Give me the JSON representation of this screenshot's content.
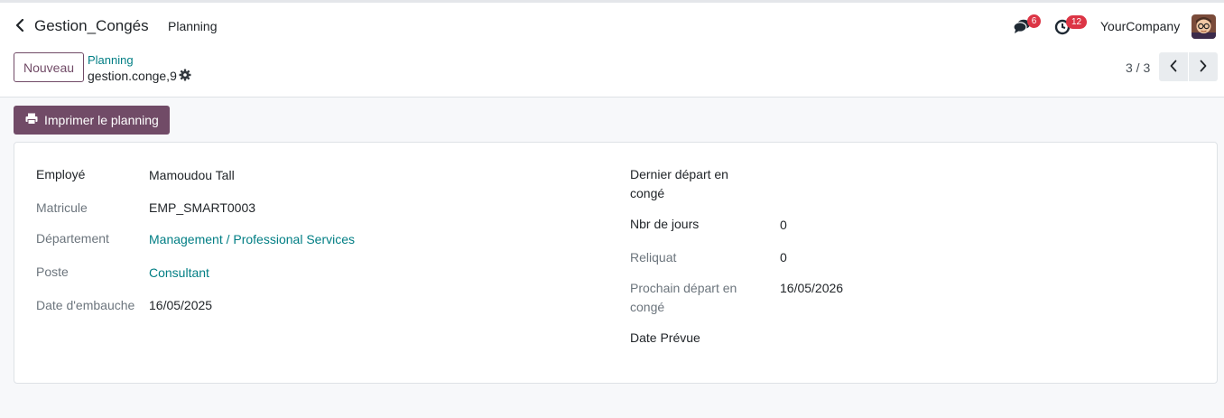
{
  "topbar": {
    "app_name": "Gestion_Congés",
    "menu_planning": "Planning",
    "messages_count": "6",
    "activities_count": "12",
    "company": "YourCompany"
  },
  "control": {
    "new_button": "Nouveau",
    "breadcrumb_parent": "Planning",
    "breadcrumb_current": "gestion.conge,9",
    "pager": "3 / 3"
  },
  "actions": {
    "print_button": "Imprimer le planning"
  },
  "form": {
    "left": {
      "employee_label": "Employé",
      "employee_value": "Mamoudou Tall",
      "matricule_label": "Matricule",
      "matricule_value": "EMP_SMART0003",
      "department_label": "Département",
      "department_value": "Management / Professional Services",
      "job_label": "Poste",
      "job_value": "Consultant",
      "hire_date_label": "Date d'embauche",
      "hire_date_value": "16/05/2025"
    },
    "right": {
      "last_departure_label_1": "Dernier départ en",
      "last_departure_label_2": "congé",
      "days_label": "Nbr de jours",
      "days_value": "0",
      "remaining_label": "Reliquat",
      "remaining_value": "0",
      "next_departure_label_1": "Prochain départ en",
      "next_departure_label_2": "congé",
      "next_departure_value": "16/05/2026",
      "planned_date_label": "Date Prévue"
    }
  },
  "icons": {
    "back": "chevron-left-icon",
    "messages": "chat-bubbles-icon",
    "activities": "clock-icon",
    "gear": "gear-icon",
    "print": "printer-icon",
    "pager_prev": "chevron-left-icon",
    "pager_next": "chevron-right-icon"
  },
  "colors": {
    "primary": "#714b67",
    "link": "#017e84",
    "badge": "#dc3545"
  }
}
